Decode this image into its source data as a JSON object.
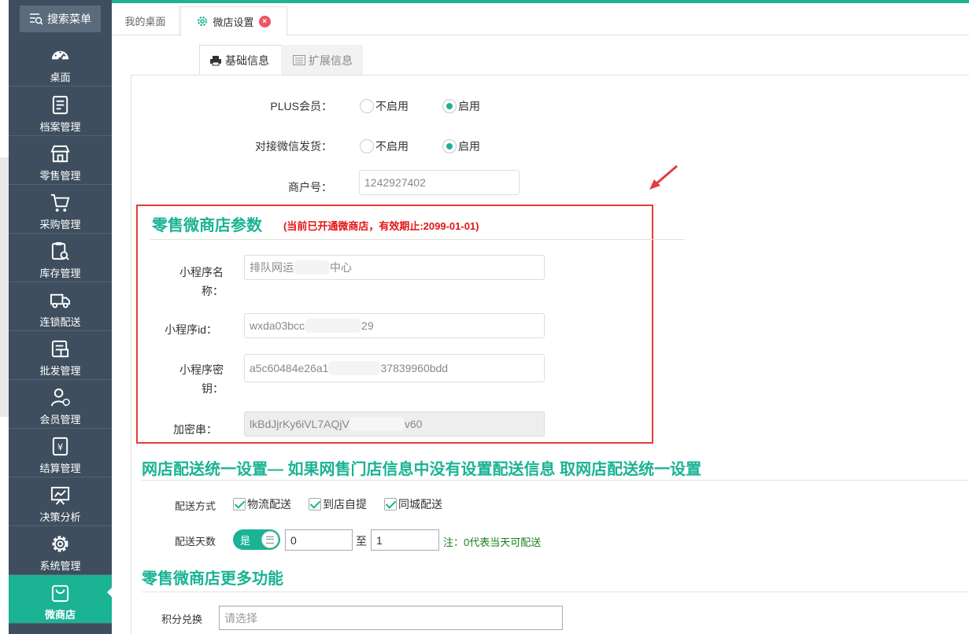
{
  "sidebar": {
    "search_label": "搜索菜单",
    "items": [
      {
        "label": "桌面",
        "icon": "dashboard-icon"
      },
      {
        "label": "档案管理",
        "icon": "archive-icon"
      },
      {
        "label": "零售管理",
        "icon": "store-icon"
      },
      {
        "label": "采购管理",
        "icon": "cart-icon"
      },
      {
        "label": "库存管理",
        "icon": "inventory-icon"
      },
      {
        "label": "连锁配送",
        "icon": "truck-icon"
      },
      {
        "label": "批发管理",
        "icon": "wholesale-icon"
      },
      {
        "label": "会员管理",
        "icon": "member-icon"
      },
      {
        "label": "结算管理",
        "icon": "yen-icon"
      },
      {
        "label": "决策分析",
        "icon": "chart-icon"
      },
      {
        "label": "系统管理",
        "icon": "gear-icon"
      },
      {
        "label": "微商店",
        "icon": "shopping-bag-icon"
      }
    ],
    "active_index": 11,
    "accent_color": "#1ab394",
    "background_color": "#3e4e5e"
  },
  "tabs": {
    "home_label": "我的桌面",
    "active_label": "微店设置",
    "close_symbol": "×"
  },
  "subtabs": {
    "basic_label": "基础信息",
    "extended_label": "扩展信息"
  },
  "form": {
    "plus_label": "PLUS会员：",
    "plus_options": [
      "不启用",
      "启用"
    ],
    "plus_selected": "启用",
    "wechat_ship_label": "对接微信发货：",
    "wechat_ship_options": [
      "不启用",
      "启用"
    ],
    "wechat_ship_selected": "启用",
    "merchant_label": "商户号：",
    "merchant_value": "1242927402"
  },
  "mini_program": {
    "title": "零售微商店参数",
    "note": "(当前已开通微商店，有效期止:2099-01-01)",
    "name_label_line1": "小程序名",
    "name_label_line2": "称：",
    "name_value_start": "排队网运",
    "name_value_end": "中心",
    "id_label": "小程序id：",
    "id_value_start": "wxda03bcc",
    "id_value_end": "29",
    "secret_label_line1": "小程序密",
    "secret_label_line2": "钥：",
    "secret_value_start": "a5c60484e26a1",
    "secret_value_end": "37839960bdd",
    "encrypt_label": "加密串：",
    "encrypt_value_start": "lkBdJjrKy6iVL7AQjV",
    "encrypt_value_end": "v60"
  },
  "delivery": {
    "title": "网店配送统一设置— 如果网售门店信息中没有设置配送信息 取网店配送统一设置",
    "method_label": "配送方式",
    "methods": [
      "物流配送",
      "到店自提",
      "同城配送"
    ],
    "days_label": "配送天数",
    "toggle_label": "是",
    "days_from": "0",
    "days_to_label": "至",
    "days_to": "1",
    "note": "注：0代表当天可配送"
  },
  "more": {
    "title": "零售微商店更多功能",
    "points_label": "积分兑换",
    "points_placeholder": "请选择"
  }
}
